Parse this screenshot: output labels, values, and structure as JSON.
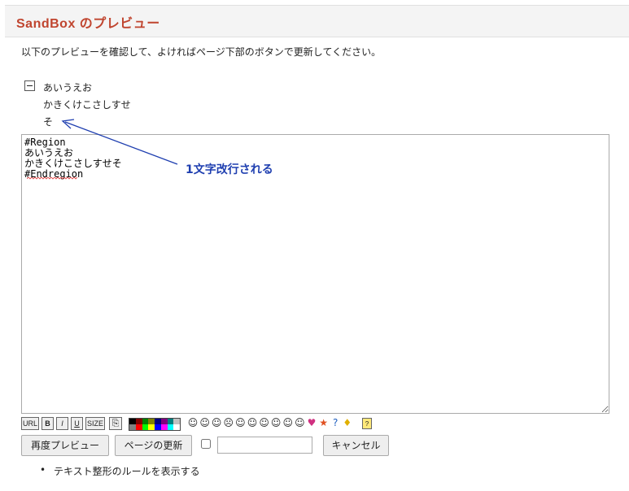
{
  "header": {
    "title": "SandBox のプレビュー"
  },
  "notice": "以下のプレビューを確認して、よければページ下部のボタンで更新してください。",
  "preview": {
    "lines": [
      "あいうえお",
      "かきくけこさしすせ",
      "そ"
    ]
  },
  "editor": {
    "content": "#Region\nあいうえお\nかきくけこさしすせそ\n#Endregion"
  },
  "annotation": {
    "text": "1文字改行される",
    "color": "#1f3fb0"
  },
  "toolbar": {
    "buttons": [
      "URL",
      "B",
      "I",
      "U",
      "SIZE"
    ],
    "palette_colors": [
      "#000000",
      "#800000",
      "#008000",
      "#808000",
      "#000080",
      "#800080",
      "#008080",
      "#c0c0c0",
      "#808080",
      "#ff0000",
      "#00ff00",
      "#ffff00",
      "#0000ff",
      "#ff00ff",
      "#00ffff",
      "#ffffff"
    ],
    "smileys": [
      "☺",
      "☺",
      "☺",
      "☹",
      "☺",
      "☺",
      "☺",
      "☺",
      "☺",
      "☺",
      "♥",
      "★",
      "?",
      "♦"
    ]
  },
  "buttons": {
    "re_preview": "再度プレビュー",
    "update": "ページの更新",
    "cancel": "キャンセル"
  },
  "links": {
    "rules": "テキスト整形のルールを表示する"
  }
}
